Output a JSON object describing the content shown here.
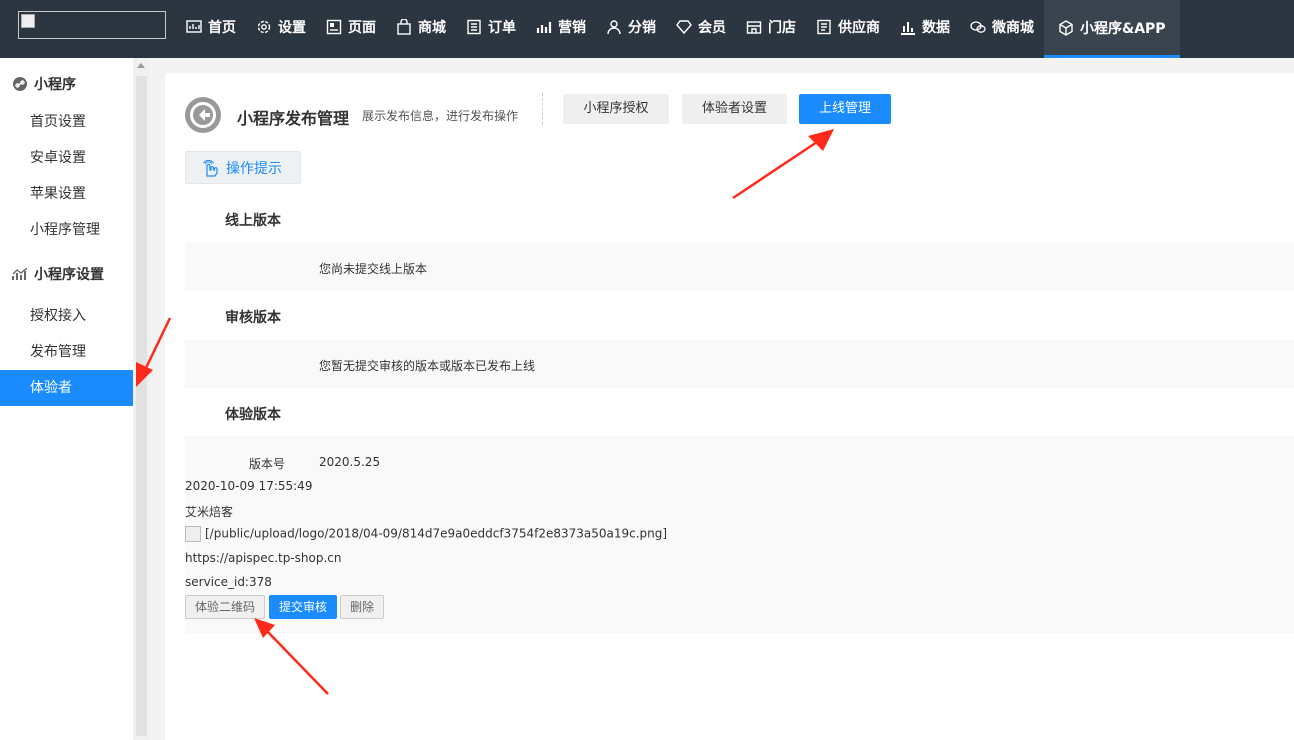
{
  "nav": {
    "items": [
      {
        "label": "首页",
        "icon": "chart-icon"
      },
      {
        "label": "设置",
        "icon": "gear-icon"
      },
      {
        "label": "页面",
        "icon": "page-icon"
      },
      {
        "label": "商城",
        "icon": "shopping-bag-icon"
      },
      {
        "label": "订单",
        "icon": "order-icon"
      },
      {
        "label": "营销",
        "icon": "marketing-icon"
      },
      {
        "label": "分销",
        "icon": "users-icon"
      },
      {
        "label": "会员",
        "icon": "diamond-icon"
      },
      {
        "label": "门店",
        "icon": "store-icon"
      },
      {
        "label": "供应商",
        "icon": "supplier-icon"
      },
      {
        "label": "数据",
        "icon": "bar-chart-icon"
      },
      {
        "label": "微商城",
        "icon": "wechat-icon"
      },
      {
        "label": "小程序&APP",
        "icon": "cube-icon"
      }
    ]
  },
  "sidebar": {
    "groups": [
      {
        "label": "小程序",
        "icon": "link-icon",
        "items": [
          "首页设置",
          "安卓设置",
          "苹果设置",
          "小程序管理"
        ]
      },
      {
        "label": "小程序设置",
        "icon": "trend-icon",
        "items": [
          "授权接入",
          "发布管理",
          "体验者"
        ]
      }
    ],
    "active_item": "体验者"
  },
  "header": {
    "title": "小程序发布管理",
    "desc": "展示发布信息，进行发布操作",
    "tabs": [
      "小程序授权",
      "体验者设置",
      "上线管理"
    ],
    "active_tab": "上线管理"
  },
  "tip_button": "操作提示",
  "sections": {
    "online": {
      "title": "线上版本",
      "msg": "您尚未提交线上版本"
    },
    "review": {
      "title": "审核版本",
      "msg": "您暂无提交审核的版本或版本已发布上线"
    },
    "experience": {
      "title": "体验版本",
      "version_label": "版本号",
      "version": "2020.5.25",
      "time": "2020-10-09 17:55:49",
      "name": "艾米焙客",
      "logo": "[/public/upload/logo/2018/04-09/814d7e9a0eddcf3754f2e8373a50a19c.png]",
      "url": "https://apispec.tp-shop.cn",
      "service_id": "service_id:378",
      "buttons": {
        "qrcode": "体验二维码",
        "submit": "提交审核",
        "delete": "删除"
      }
    }
  },
  "colors": {
    "accent": "#1a8cff",
    "topbar": "#2c3640",
    "annotation": "#ff2a1a"
  }
}
